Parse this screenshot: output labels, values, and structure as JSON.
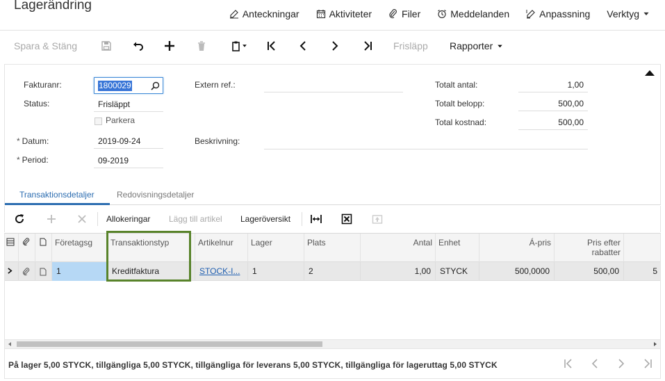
{
  "header": {
    "title": "Lagerändring",
    "links": [
      {
        "name": "notes",
        "label": "Anteckningar"
      },
      {
        "name": "activities",
        "label": "Aktiviteter"
      },
      {
        "name": "files",
        "label": "Filer"
      },
      {
        "name": "notifications",
        "label": "Meddelanden"
      },
      {
        "name": "customization",
        "label": "Anpassning"
      },
      {
        "name": "tools",
        "label": "Verktyg"
      }
    ]
  },
  "toolbar": {
    "save_close_label": "Spara & Stäng",
    "release_label": "Frisläpp",
    "reports_label": "Rapporter"
  },
  "form": {
    "ref_nbr_label": "Fakturanr:",
    "ref_nbr_value": "1800029",
    "status_label": "Status:",
    "status_value": "Frisläppt",
    "hold_label": "Parkera",
    "date_label": "Datum:",
    "date_value": "2019-09-24",
    "period_label": "Period:",
    "period_value": "09-2019",
    "ext_ref_label": "Extern ref.:",
    "ext_ref_value": "",
    "description_label": "Beskrivning:",
    "description_value": "",
    "total_qty_label": "Totalt antal:",
    "total_qty_value": "1,00",
    "total_amount_label": "Totalt belopp:",
    "total_amount_value": "500,00",
    "total_cost_label": "Total kostnad:",
    "total_cost_value": "500,00",
    "required_marker": "*"
  },
  "tabs": [
    {
      "label": "Transaktionsdetaljer"
    },
    {
      "label": "Redovisningsdetaljer"
    }
  ],
  "grid_toolbar": {
    "allocations_label": "Allokeringar",
    "add_item_label": "Lägg till artikel",
    "inventory_summary_label": "Lageröversikt"
  },
  "grid": {
    "columns": [
      "Företagsg",
      "Transaktionstyp",
      "Artikelnur",
      "Lager",
      "Plats",
      "Antal",
      "Enhet",
      "Á-pris",
      "Pris efter rabatter"
    ],
    "row": {
      "branch": "1",
      "tran_type": "Kreditfaktura",
      "item": "STOCK-I...",
      "warehouse": "1",
      "location": "2",
      "qty": "1,00",
      "uom": "STYCK",
      "unit_price": "500,0000",
      "discounted_price": "500,00",
      "overflow": "5"
    }
  },
  "footer": {
    "text": "På lager 5,00 STYCK, tillgängliga 5,00 STYCK, tillgängliga för leverans 5,00 STYCK, tillgängliga för lageruttag 5,00 STYCK"
  },
  "colors": {
    "accent": "#2b6cb0",
    "highlight": "#58832a",
    "selected_cell": "#b6d8f5"
  }
}
